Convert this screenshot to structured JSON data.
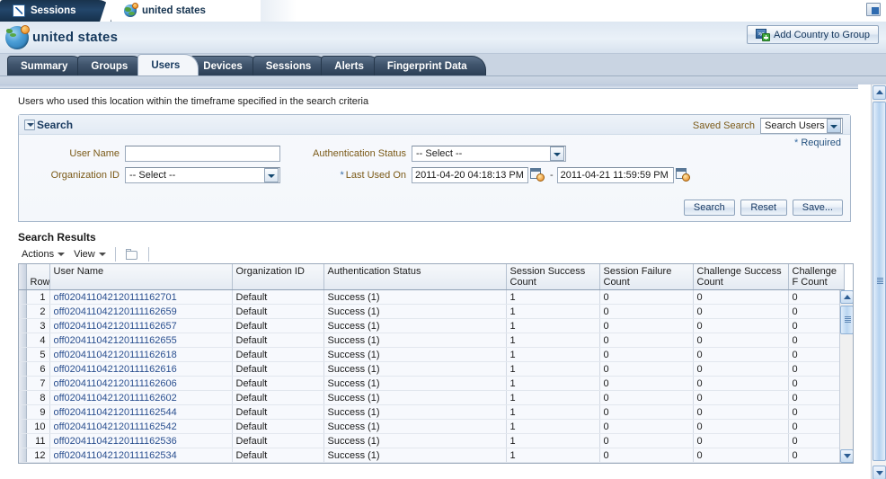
{
  "browser_tabs": [
    {
      "label": "Sessions",
      "icon": "chart-icon",
      "active": false
    },
    {
      "label": "united states",
      "icon": "globe-pin-icon",
      "active": true
    }
  ],
  "header": {
    "title": "united states",
    "icon": "globe-pin-icon",
    "add_button": {
      "label": "Add Country to Group",
      "icon": "add-country-icon"
    },
    "corner_icon": "restore-window-icon",
    "corner_glyph": "x"
  },
  "app_tabs": [
    {
      "label": "Summary",
      "selected": false
    },
    {
      "label": "Groups",
      "selected": false
    },
    {
      "label": "Users",
      "selected": true
    },
    {
      "label": "Devices",
      "selected": false
    },
    {
      "label": "Sessions",
      "selected": false
    },
    {
      "label": "Alerts",
      "selected": false
    },
    {
      "label": "Fingerprint Data",
      "selected": false
    }
  ],
  "description": "Users who used this location within the timeframe specified in the search criteria",
  "search": {
    "title": "Search",
    "disclose_icon": "chevron-down-icon",
    "saved_search_label": "Saved Search",
    "saved_search_value": "Search Users",
    "required_note": "Required",
    "required_star": "*",
    "fields": {
      "user_name_label": "User Name",
      "user_name_value": "",
      "user_name_placeholder": "",
      "organization_id_label": "Organization ID",
      "organization_id_value": "-- Select --",
      "auth_status_label": "Authentication Status",
      "auth_status_value": "-- Select --",
      "last_used_on_label": "Last Used On",
      "last_used_on_from": "2011-04-20 04:18:13 PM",
      "last_used_on_to": "2011-04-21 11:59:59 PM",
      "range_separator": "-",
      "calendar_icon": "calendar-clock-icon"
    },
    "buttons": [
      {
        "label": "Search"
      },
      {
        "label": "Reset"
      },
      {
        "label": "Save..."
      }
    ]
  },
  "results": {
    "title": "Search Results",
    "toolbar": {
      "actions_label": "Actions",
      "view_label": "View",
      "detach_icon": "detach-folder-icon"
    },
    "columns": [
      "Row",
      "User Name",
      "Organization ID",
      "Authentication Status",
      "Session Success Count",
      "Session Failure Count",
      "Challenge Success Count",
      "Challenge F Count"
    ],
    "rows": [
      {
        "row": "1",
        "user": "off020411042120111162701",
        "org": "Default",
        "auth": "Success (1)",
        "ss": "1",
        "sf": "0",
        "cs": "0",
        "cf": "0"
      },
      {
        "row": "2",
        "user": "off020411042120111162659",
        "org": "Default",
        "auth": "Success (1)",
        "ss": "1",
        "sf": "0",
        "cs": "0",
        "cf": "0"
      },
      {
        "row": "3",
        "user": "off020411042120111162657",
        "org": "Default",
        "auth": "Success (1)",
        "ss": "1",
        "sf": "0",
        "cs": "0",
        "cf": "0"
      },
      {
        "row": "4",
        "user": "off020411042120111162655",
        "org": "Default",
        "auth": "Success (1)",
        "ss": "1",
        "sf": "0",
        "cs": "0",
        "cf": "0"
      },
      {
        "row": "5",
        "user": "off020411042120111162618",
        "org": "Default",
        "auth": "Success (1)",
        "ss": "1",
        "sf": "0",
        "cs": "0",
        "cf": "0"
      },
      {
        "row": "6",
        "user": "off020411042120111162616",
        "org": "Default",
        "auth": "Success (1)",
        "ss": "1",
        "sf": "0",
        "cs": "0",
        "cf": "0"
      },
      {
        "row": "7",
        "user": "off020411042120111162606",
        "org": "Default",
        "auth": "Success (1)",
        "ss": "1",
        "sf": "0",
        "cs": "0",
        "cf": "0"
      },
      {
        "row": "8",
        "user": "off020411042120111162602",
        "org": "Default",
        "auth": "Success (1)",
        "ss": "1",
        "sf": "0",
        "cs": "0",
        "cf": "0"
      },
      {
        "row": "9",
        "user": "off020411042120111162544",
        "org": "Default",
        "auth": "Success (1)",
        "ss": "1",
        "sf": "0",
        "cs": "0",
        "cf": "0"
      },
      {
        "row": "10",
        "user": "off020411042120111162542",
        "org": "Default",
        "auth": "Success (1)",
        "ss": "1",
        "sf": "0",
        "cs": "0",
        "cf": "0"
      },
      {
        "row": "11",
        "user": "off020411042120111162536",
        "org": "Default",
        "auth": "Success (1)",
        "ss": "1",
        "sf": "0",
        "cs": "0",
        "cf": "0"
      },
      {
        "row": "12",
        "user": "off020411042120111162534",
        "org": "Default",
        "auth": "Success (1)",
        "ss": "1",
        "sf": "0",
        "cs": "0",
        "cf": "0"
      }
    ]
  },
  "colors": {
    "tab_dark": "#2c3f55",
    "label_brown": "#7b5a18",
    "link_blue": "#2a4f8f",
    "header_blue": "#15385c"
  }
}
